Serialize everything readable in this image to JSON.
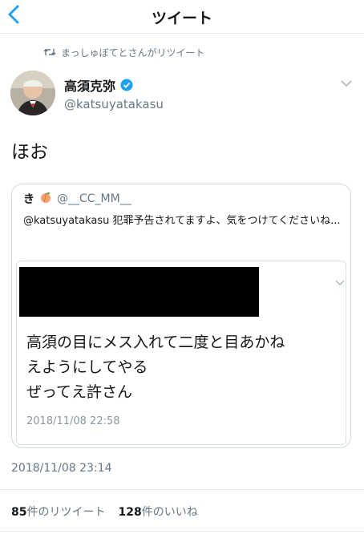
{
  "navbar": {
    "back_glyph": "<",
    "title": "ツイート"
  },
  "retweet": {
    "icon": "retweet-icon",
    "text": "まっしゅぼてとさんがリツイート"
  },
  "tweet": {
    "author_name": "高須克弥",
    "author_handle": "@katsuyatakasu",
    "text": "ほお",
    "timestamp": "2018/11/08 23:14",
    "stats": {
      "retweets_count": "85",
      "retweets_label": "件のリツイート",
      "likes_count": "128",
      "likes_label": "件のいいね"
    }
  },
  "quoted": {
    "author_name": "き",
    "author_emoji": "peach-icon",
    "author_handle": "@__CC_MM__",
    "text": "@katsuyatakasu 犯罪予告されてますよ、気をつけてくださいね...",
    "card": {
      "body_lines": [
        "高須の目にメス入れて二度と目あかね",
        "えようにしてやる",
        "ぜってえ許さん"
      ],
      "timestamp": "2018/11/08 22:58"
    }
  },
  "colors": {
    "accent": "#1da1f2",
    "secondary_text": "#657786",
    "border": "#e1e8ed",
    "redaction": "#000000"
  }
}
